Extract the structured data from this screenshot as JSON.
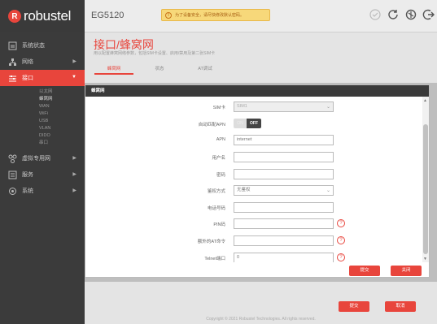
{
  "header": {
    "brand": "robustel",
    "brand_mark": "R",
    "model": "EG5120",
    "alert_text": "为了设备安全，请尽快修改默认密码。",
    "alert_icon": "info-icon",
    "icons": [
      "refresh-icon",
      "settings-icon",
      "logout-icon"
    ]
  },
  "sidebar": {
    "items": [
      {
        "label": "系统状态",
        "icon": "status-icon",
        "has_arrow": false
      },
      {
        "label": "网络",
        "icon": "network-icon",
        "has_arrow": true
      },
      {
        "label": "接口",
        "icon": "interface-icon",
        "has_arrow": true,
        "active": true
      }
    ],
    "subitems": [
      "以太网",
      "蜂窝网",
      "WAN",
      "WiFi",
      "USB",
      "VLAN",
      "DIDO",
      "串口"
    ],
    "current_sub": "蜂窝网",
    "lower_items": [
      {
        "label": "虚拟专用网",
        "icon": "vpn-icon",
        "has_arrow": true
      },
      {
        "label": "服务",
        "icon": "service-icon",
        "has_arrow": true
      },
      {
        "label": "系统",
        "icon": "system-icon",
        "has_arrow": true
      }
    ]
  },
  "page": {
    "title": "接口/蜂窝网",
    "description": "用以配置蜂窝网络参数，包括SIM卡设置、启用/禁用及第二张SIM卡",
    "tabs": [
      "蜂窝网",
      "状态",
      "AT调试"
    ],
    "active_tab": 0,
    "copyright": "Copyright © 2021 Robustel Technologies. All rights reserved.",
    "submit_label": "提交",
    "cancel_label": "取消"
  },
  "modal": {
    "title": "蜂窝网",
    "fields": [
      {
        "label": "SIM卡",
        "type": "select",
        "value": "SIM1",
        "disabled": true
      },
      {
        "label": "自动匹配APN",
        "type": "toggle",
        "on_label": "ON",
        "off_label": "OFF",
        "value": "OFF"
      },
      {
        "label": "APN",
        "type": "text",
        "value": "internet"
      },
      {
        "label": "用户名",
        "type": "text",
        "value": ""
      },
      {
        "label": "密码",
        "type": "text",
        "value": ""
      },
      {
        "label": "鉴权方式",
        "type": "select",
        "value": "无鉴权"
      },
      {
        "label": "电话号码",
        "type": "text",
        "value": ""
      },
      {
        "label": "PIN码",
        "type": "text",
        "value": "",
        "help": true
      },
      {
        "label": "额外的AT命令",
        "type": "text",
        "value": "",
        "help": true
      },
      {
        "label": "Telnet端口",
        "type": "text",
        "value": "0",
        "help": true
      }
    ],
    "help_symbol": "?",
    "submit_label": "提交",
    "close_label": "关闭"
  }
}
